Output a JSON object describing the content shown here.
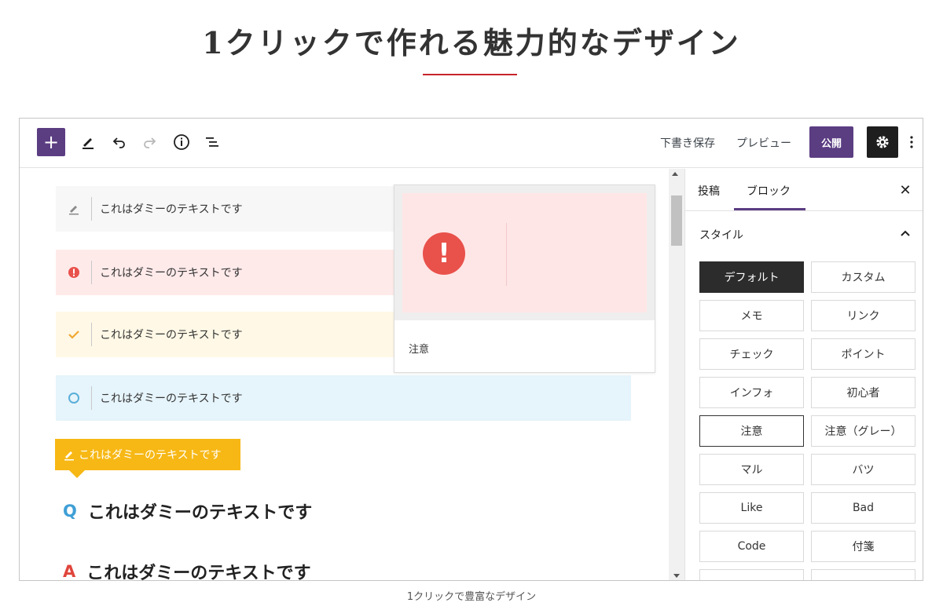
{
  "page": {
    "headline": "1クリックで作れる魅力的なデザイン",
    "caption": "1クリックで豊富なデザイン",
    "accent_rule_color": "#c8242b"
  },
  "toolbar": {
    "add_icon": "plus-icon",
    "tools_icon": "pencil-icon",
    "undo_icon": "undo-icon",
    "redo_icon": "redo-icon",
    "info_icon": "info-icon",
    "outline_icon": "list-view-icon",
    "save_draft_label": "下書き保存",
    "preview_label": "プレビュー",
    "publish_label": "公開",
    "settings_icon": "gear-icon",
    "more_icon": "vertical-ellipsis-icon",
    "brand_color": "#5b3d82"
  },
  "editor": {
    "boxes": [
      {
        "style": "memo",
        "icon": "pencil-icon",
        "text": "これはダミーのテキストです",
        "color": "#f7f7f7"
      },
      {
        "style": "alert",
        "icon": "exclamation-icon",
        "text": "これはダミーのテキストです",
        "color": "#ffeaea"
      },
      {
        "style": "check",
        "icon": "check-icon",
        "text": "これはダミーのテキストです",
        "color": "#fff8e6"
      },
      {
        "style": "info",
        "icon": "circle-icon",
        "text": "これはダミーのテキストです",
        "color": "#e6f4fb"
      }
    ],
    "label_box": {
      "icon": "pencil-icon",
      "text": "これはダミーのテキストです",
      "color": "#f7b815"
    },
    "qa": [
      {
        "mark": "Q",
        "text": "これはダミーのテキストです",
        "color": "#3f9fd6"
      },
      {
        "mark": "A",
        "text": "これはダミーのテキストです",
        "color": "#e0453c"
      }
    ]
  },
  "popup": {
    "preview_icon": "exclamation-circle-icon",
    "glyph": "!",
    "label": "注意"
  },
  "sidebar": {
    "tabs": [
      "投稿",
      "ブロック"
    ],
    "active_tab": "ブロック",
    "close_icon": "close-icon",
    "panel_title": "スタイル",
    "panel_icon": "chevron-up-icon",
    "styles": [
      "デフォルト",
      "カスタム",
      "メモ",
      "リンク",
      "チェック",
      "ポイント",
      "インフォ",
      "初心者",
      "注意",
      "注意（グレー）",
      "マル",
      "バツ",
      "Like",
      "Bad",
      "Code",
      "付箋",
      "",
      ""
    ],
    "active_style": "デフォルト",
    "hovered_style": "注意"
  }
}
